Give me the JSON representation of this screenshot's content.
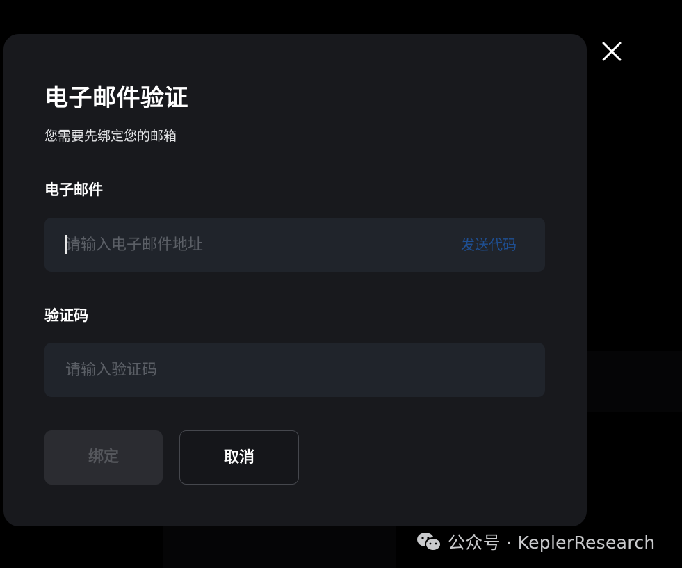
{
  "dialog": {
    "title": "电子邮件验证",
    "subtitle": "您需要先绑定您的邮箱",
    "close_icon": "close-icon"
  },
  "email": {
    "label": "电子邮件",
    "placeholder": "请输入电子邮件地址",
    "value": "",
    "send_code_label": "发送代码"
  },
  "code": {
    "label": "验证码",
    "placeholder": "请输入验证码",
    "value": ""
  },
  "actions": {
    "bind_label": "绑定",
    "cancel_label": "取消"
  },
  "watermark": {
    "text": "公众号 · KeplerResearch",
    "icon": "wechat-icon"
  },
  "colors": {
    "modal_bg": "#18191d",
    "input_bg": "#20242b",
    "link": "#1e4f93",
    "disabled_button_bg": "#2b2c31",
    "disabled_button_text": "#55575c"
  }
}
